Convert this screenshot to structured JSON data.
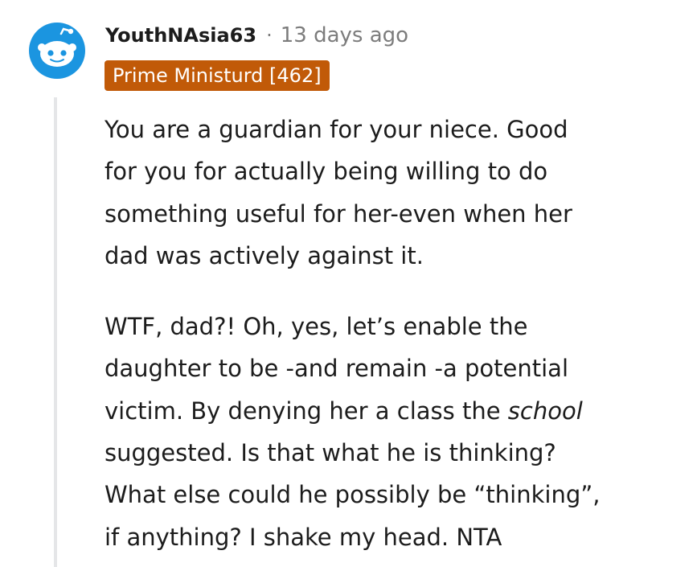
{
  "comment": {
    "username": "YouthNAsia63",
    "separator": "·",
    "timestamp": "13 days ago",
    "flair": "Prime Ministurd [462]",
    "avatar_icon": "reddit-snoo-icon",
    "colors": {
      "flair_background": "#c15a08",
      "flair_text": "#ffffff",
      "avatar_background": "#1b95e0",
      "username": "#1c1c1c",
      "meta_text": "#7c7c7c",
      "thread_line": "#e5e6e8"
    },
    "paragraphs": [
      {
        "lines": [
          "You are a guardian for your niece. Good",
          "for you for actually being willing to do",
          "something useful for her-even when her",
          "dad was actively against it."
        ]
      },
      {
        "lines": [
          "WTF, dad?! Oh, yes, let’s enable the",
          "daughter to be -and remain -a potential",
          "victim. By denying her a class the ",
          "school",
          "suggested. Is that what he is thinking?",
          "What else could he possibly be “thinking”,",
          "if anything? I shake my head. NTA"
        ]
      }
    ]
  }
}
